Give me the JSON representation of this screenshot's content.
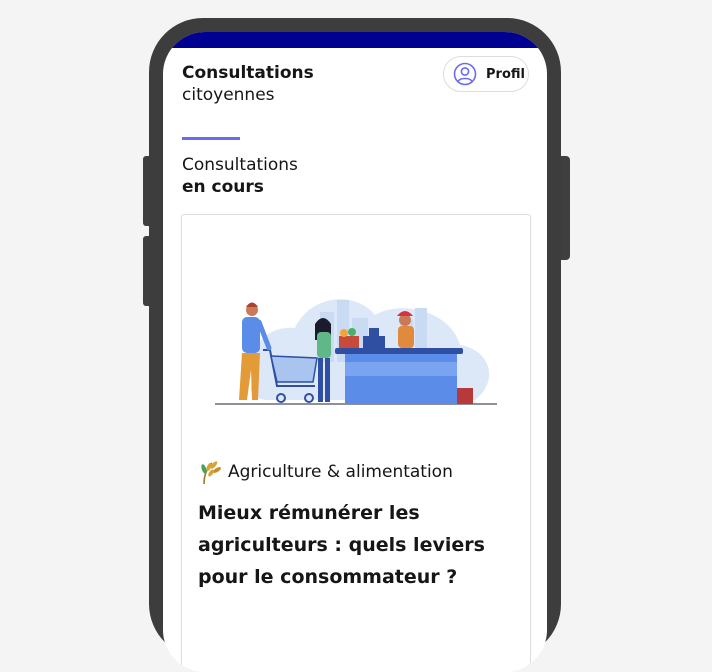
{
  "app": {
    "title_line1": "Consultations",
    "title_line2": "citoyennes"
  },
  "header": {
    "profile_label": "Profil"
  },
  "section": {
    "title_line1": "Consultations",
    "title_line2": "en cours"
  },
  "card": {
    "category": "Agriculture & alimentation",
    "title": "Mieux rémunérer les agriculteurs : quels leviers pour le consommateur ?"
  },
  "colors": {
    "brand_blue": "#000091",
    "accent": "#6a6af4",
    "text": "#161616",
    "phone_frame": "#3d3d3d"
  },
  "icons": {
    "profile": "user-circle-icon",
    "category": "wheat-icon"
  }
}
